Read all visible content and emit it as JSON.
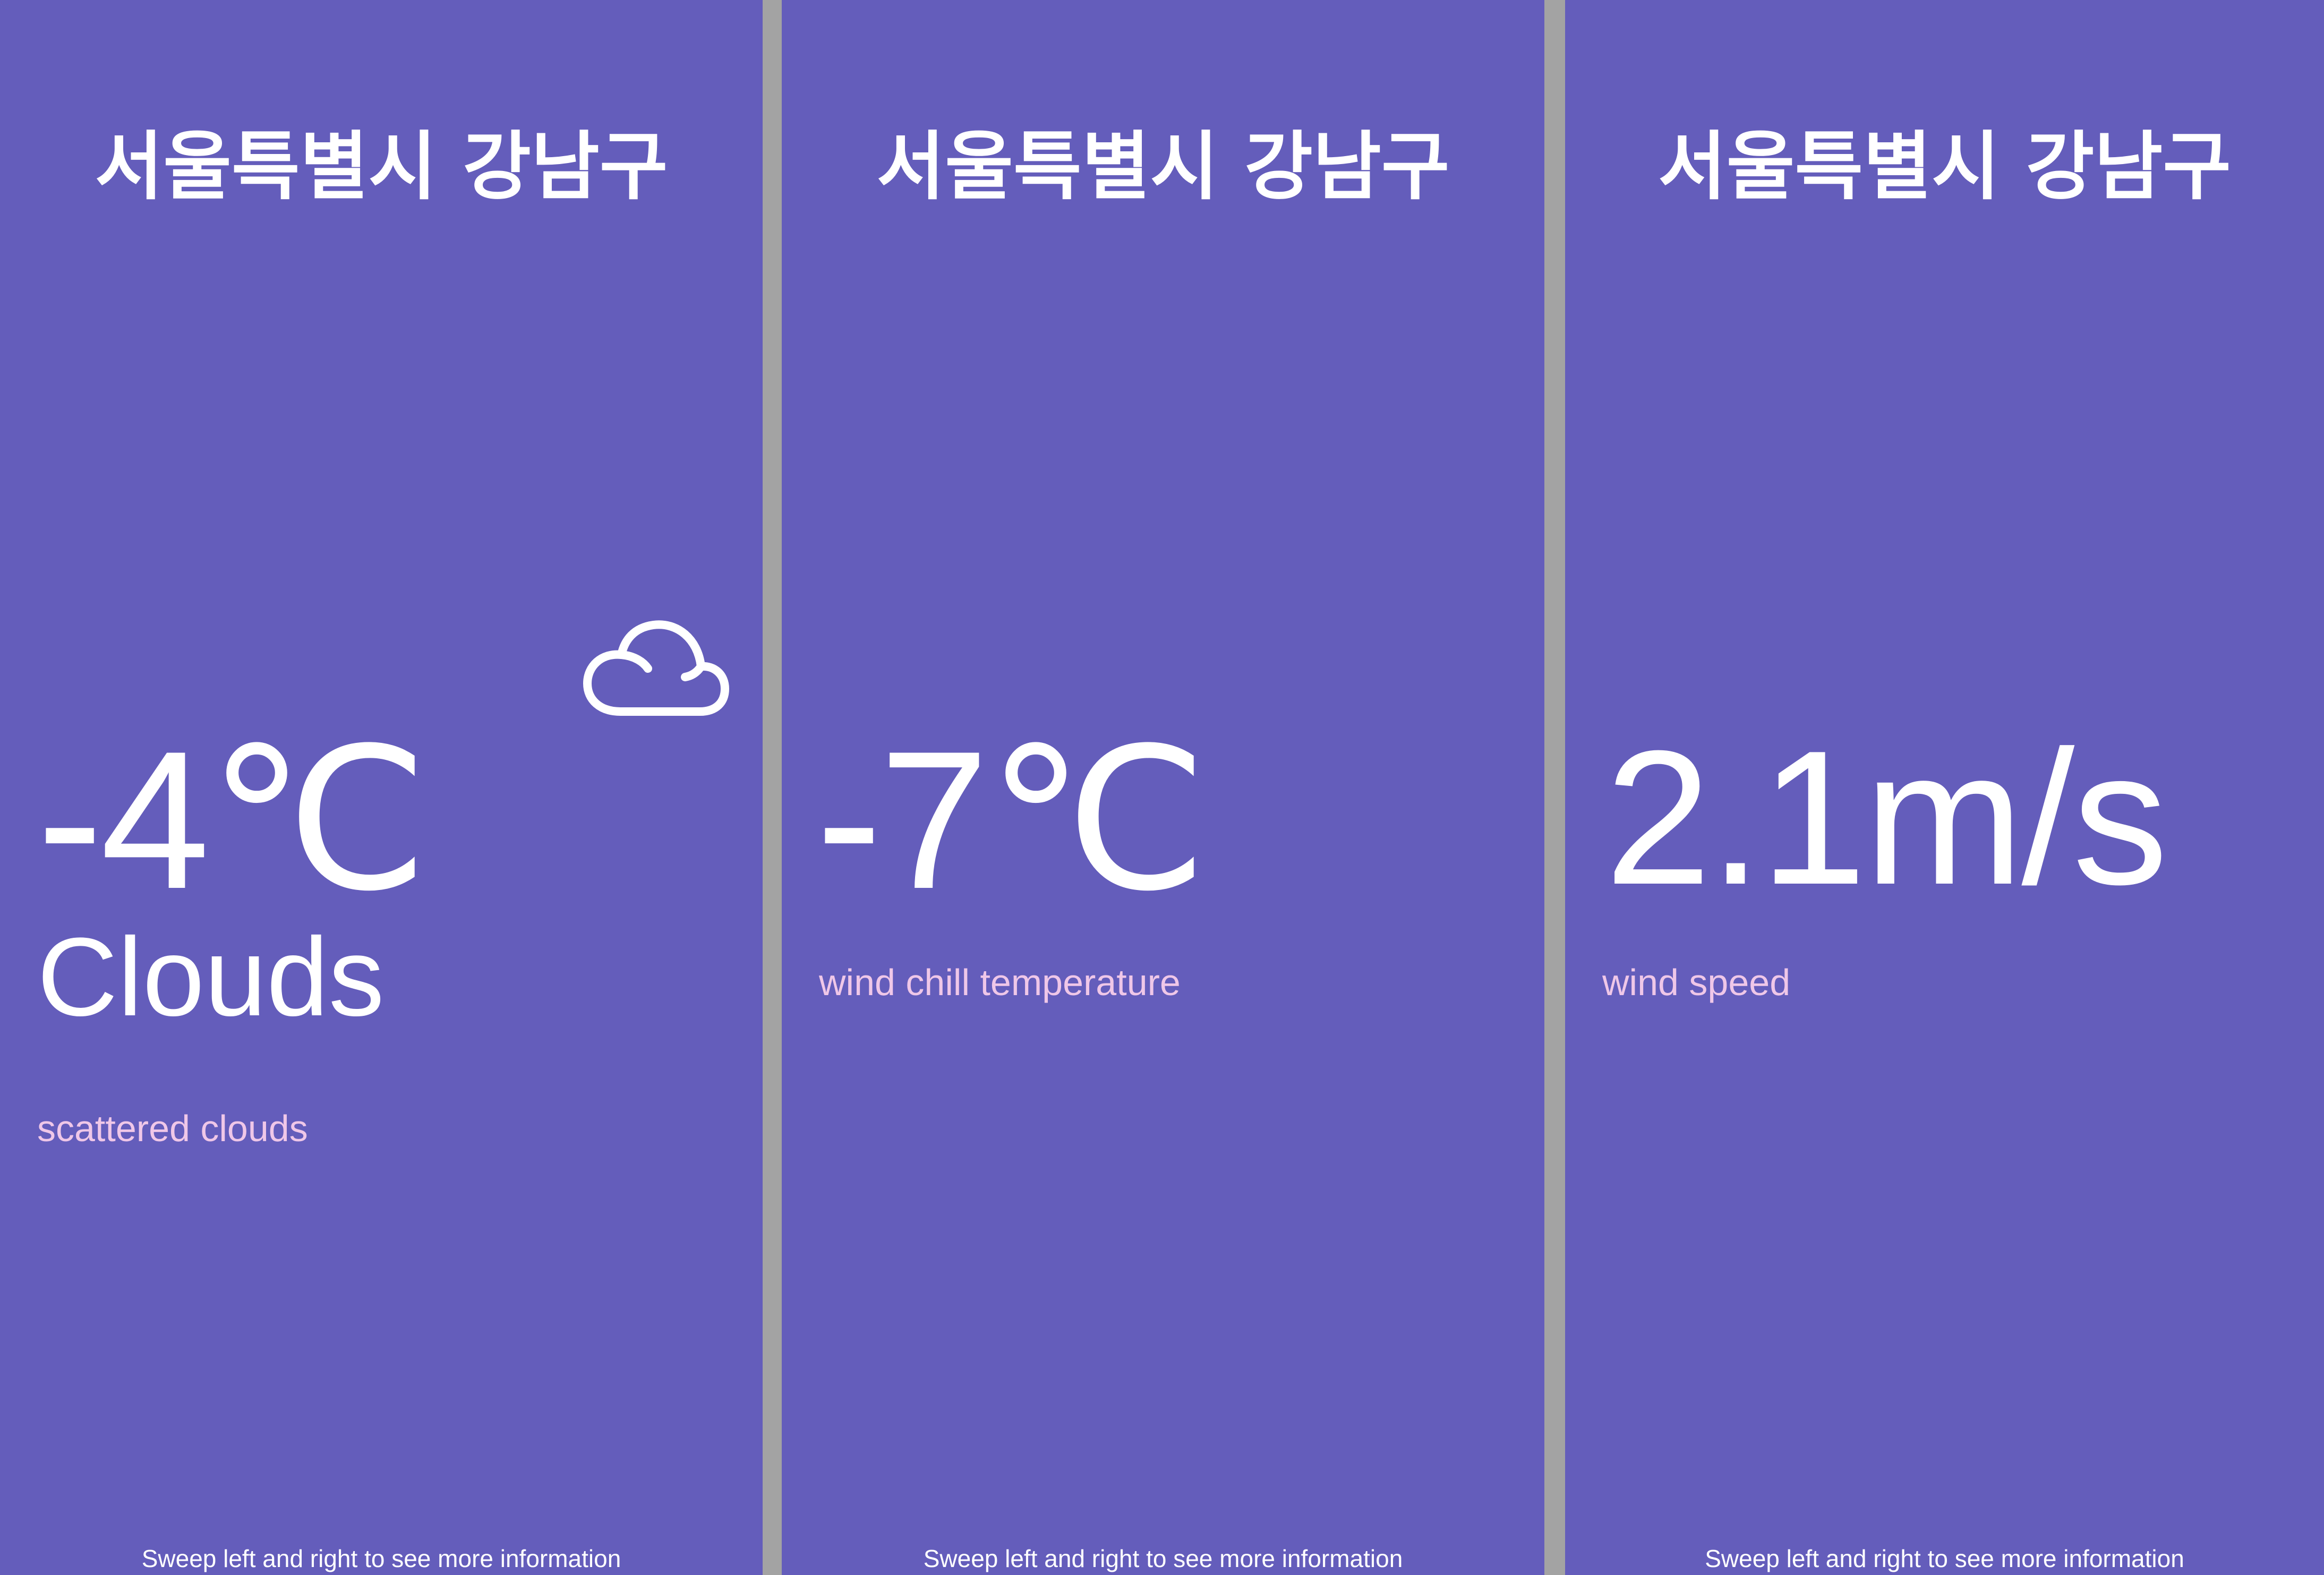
{
  "colors": {
    "background": "#645dbb",
    "divider": "#a3a3a3",
    "primary_text": "#ffffff",
    "secondary_text": "#efc7e8"
  },
  "screens": [
    {
      "location": "서울특별시 강남구",
      "value": "-4℃",
      "condition": "Clouds",
      "description": "scattered clouds",
      "icon": "cloud-icon",
      "hint": "Sweep left and right to see more information"
    },
    {
      "location": "서울특별시 강남구",
      "value": "-7℃",
      "description": "wind chill temperature",
      "hint": "Sweep left and right to see more information"
    },
    {
      "location": "서울특별시 강남구",
      "value": "2.1m/s",
      "description": "wind speed",
      "hint": "Sweep left and right to see more information"
    }
  ]
}
